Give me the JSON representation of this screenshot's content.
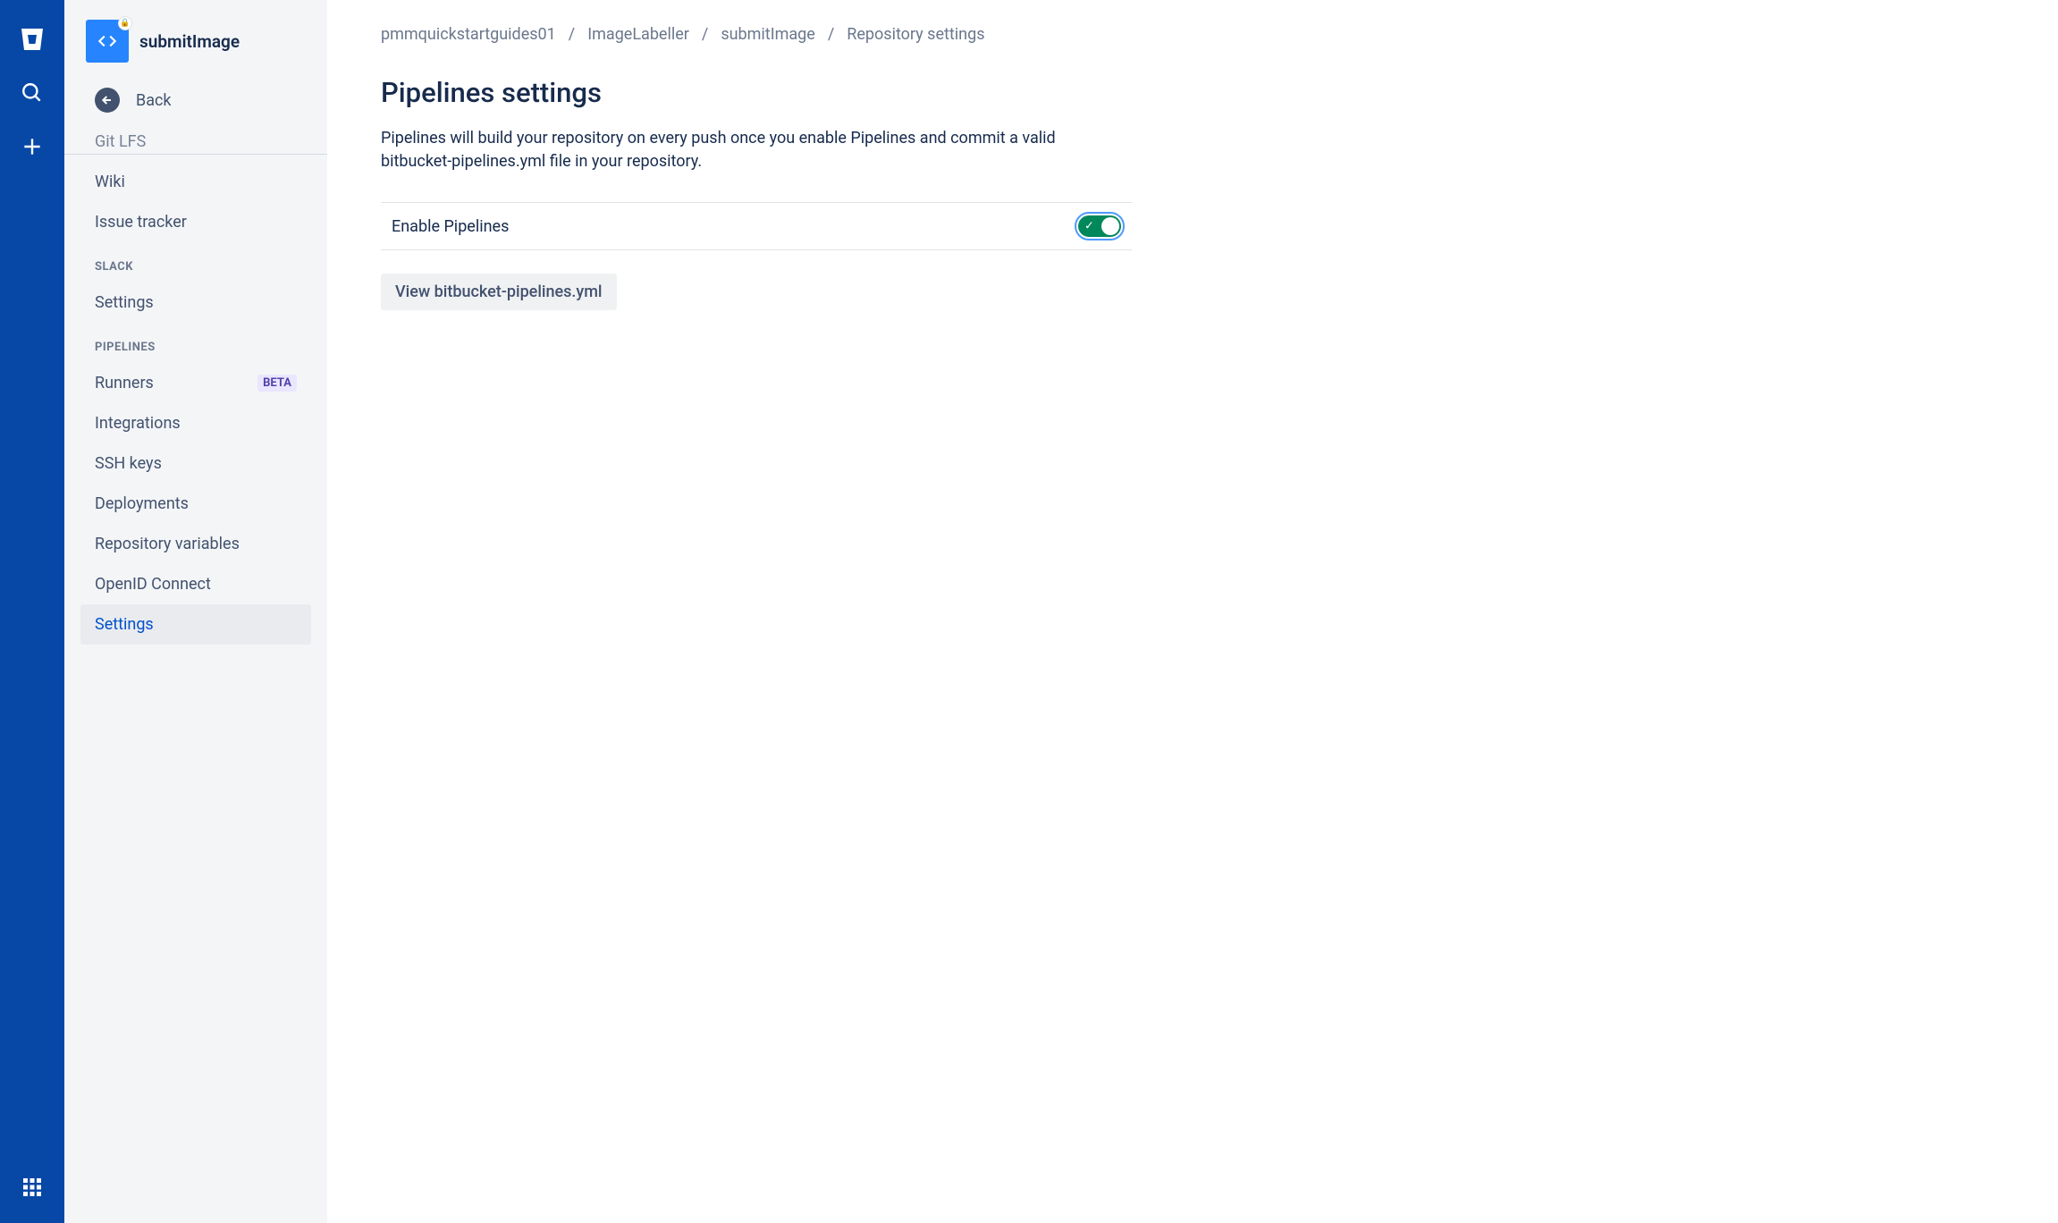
{
  "sidebar": {
    "repo_name": "submitImage",
    "back_label": "Back",
    "items_top": [
      {
        "label": "Git LFS"
      },
      {
        "label": "Wiki"
      },
      {
        "label": "Issue tracker"
      }
    ],
    "section_slack": "SLACK",
    "slack_items": [
      {
        "label": "Settings"
      }
    ],
    "section_pipelines": "PIPELINES",
    "pipelines_items": [
      {
        "label": "Runners",
        "badge": "BETA"
      },
      {
        "label": "Integrations"
      },
      {
        "label": "SSH keys"
      },
      {
        "label": "Deployments"
      },
      {
        "label": "Repository variables"
      },
      {
        "label": "OpenID Connect"
      },
      {
        "label": "Settings",
        "selected": true
      }
    ]
  },
  "breadcrumb": {
    "items": [
      "pmmquickstartguides01",
      "ImageLabeller",
      "submitImage",
      "Repository settings"
    ]
  },
  "main": {
    "title": "Pipelines settings",
    "description": "Pipelines will build your repository on every push once you enable Pipelines and commit a valid bitbucket-pipelines.yml file in your repository.",
    "toggle_label": "Enable Pipelines",
    "toggle_on": true,
    "view_button": "View bitbucket-pipelines.yml"
  }
}
